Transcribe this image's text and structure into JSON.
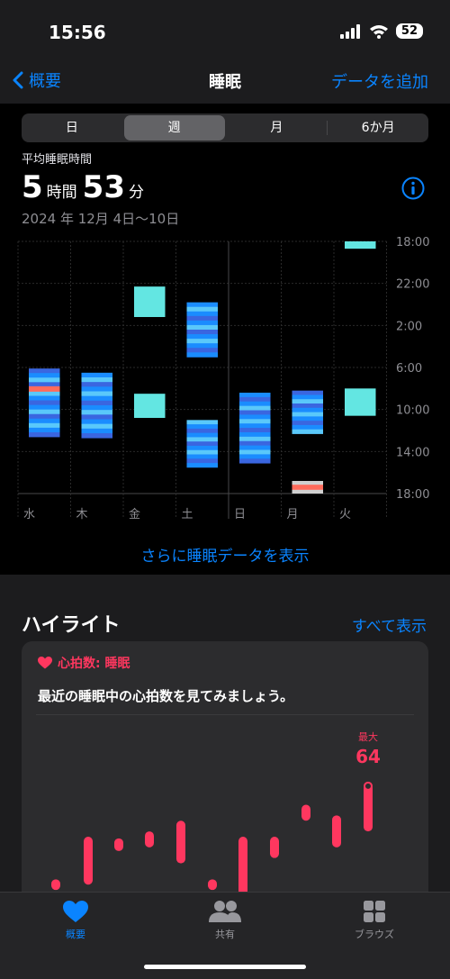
{
  "status": {
    "time": "15:56",
    "battery": "52"
  },
  "nav": {
    "back_label": "概要",
    "title": "睡眠",
    "add_label": "データを追加"
  },
  "segments": [
    {
      "label": "日",
      "selected": false
    },
    {
      "label": "週",
      "selected": true
    },
    {
      "label": "月",
      "selected": false
    },
    {
      "label": "6か月",
      "selected": false
    }
  ],
  "summary": {
    "label": "平均睡眠時間",
    "hours": "5",
    "hours_unit": "時間",
    "minutes": "53",
    "minutes_unit": "分",
    "date_range": "2024 年 12月 4日〜10日"
  },
  "chart_data": {
    "type": "bar",
    "categories": [
      "水",
      "木",
      "金",
      "土",
      "日",
      "月",
      "火"
    ],
    "y_ticks": [
      "18:00",
      "22:00",
      "2:00",
      "6:00",
      "10:00",
      "14:00",
      "18:00"
    ],
    "y_range_hours": [
      18,
      42
    ],
    "colors": {
      "deep": "#1a8cff",
      "core": "#3a66e0",
      "rem": "#5ac8fa",
      "awake": "#ff6b5b",
      "in_bed": "#63e6e2"
    },
    "sessions": [
      {
        "day": "水",
        "start": 30.1,
        "end": 36.6,
        "kind": "stages"
      },
      {
        "day": "木",
        "start": 30.5,
        "end": 36.7,
        "kind": "stages"
      },
      {
        "day": "金",
        "start": 22.3,
        "end": 25.2,
        "kind": "in_bed"
      },
      {
        "day": "金",
        "start": 32.5,
        "end": 34.8,
        "kind": "in_bed"
      },
      {
        "day": "土",
        "start": 23.8,
        "end": 29.0,
        "kind": "stages"
      },
      {
        "day": "土",
        "start": 35.0,
        "end": 39.5,
        "kind": "stages"
      },
      {
        "day": "日",
        "start": 32.4,
        "end": 39.1,
        "kind": "stages"
      },
      {
        "day": "月",
        "start": 32.2,
        "end": 36.3,
        "kind": "stages"
      },
      {
        "day": "月",
        "start": 40.8,
        "end": 42.0,
        "kind": "awake_mix"
      },
      {
        "day": "火",
        "start": 18.0,
        "end": 18.7,
        "kind": "in_bed"
      },
      {
        "day": "火",
        "start": 32.0,
        "end": 34.6,
        "kind": "in_bed"
      }
    ]
  },
  "show_more": "さらに睡眠データを表示",
  "highlights": {
    "title": "ハイライト",
    "see_all": "すべて表示",
    "card": {
      "tag": "心拍数: 睡眠",
      "text": "最近の睡眠中の心拍数を見てみましょう。",
      "max_label": "最大",
      "max_value": "64",
      "heart_rate": {
        "type": "range-bar",
        "min_visible": 44,
        "max_visible": 64,
        "bars": [
          [
            44,
            46
          ],
          [
            45,
            54
          ],
          [
            52,
            53
          ],
          [
            52,
            55
          ],
          [
            49,
            57
          ],
          [
            44,
            46
          ],
          [
            43,
            54
          ],
          [
            50,
            54
          ],
          [
            57,
            60
          ],
          [
            52,
            58
          ],
          [
            55,
            64
          ]
        ]
      }
    }
  },
  "tabs": [
    {
      "label": "概要",
      "icon": "heart-icon",
      "active": true
    },
    {
      "label": "共有",
      "icon": "people-icon",
      "active": false
    },
    {
      "label": "ブラウズ",
      "icon": "grid-icon",
      "active": false
    }
  ]
}
